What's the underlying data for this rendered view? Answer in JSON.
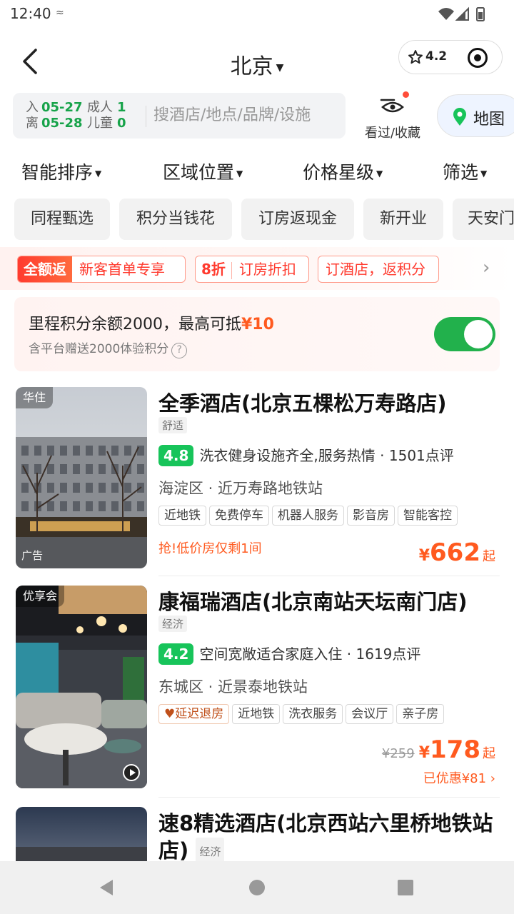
{
  "status_bar": {
    "time": "12:40"
  },
  "header": {
    "city": "北京",
    "capsule_rating": "4.2"
  },
  "search": {
    "checkin_label": "入",
    "checkin_date": "05-27",
    "checkout_label": "离",
    "checkout_date": "05-28",
    "adults_label": "成人",
    "adults": "1",
    "children_label": "儿童",
    "children": "0",
    "placeholder": "搜酒店/地点/品牌/设施",
    "viewed_label": "看过/收藏",
    "map_label": "地图"
  },
  "sort_bar": [
    "智能排序",
    "区域位置",
    "价格星级",
    "筛选"
  ],
  "quick_chips": [
    "同程甄选",
    "积分当钱花",
    "订房返现金",
    "新开业",
    "天安门"
  ],
  "promos": [
    {
      "lead": "全额返",
      "rest": "新客首单专享"
    },
    {
      "lead": "8折",
      "rest": "订房折扣"
    },
    {
      "lead": "",
      "rest": "订酒店，返积分"
    }
  ],
  "points_card": {
    "main_text": "里程积分余额2000，最高可抵",
    "highlight": "¥10",
    "sub_text": "含平台赠送2000体验积分",
    "toggle_on": true
  },
  "hotels": [
    {
      "badge": "华住",
      "ad_label": "广告",
      "name": "全季酒店(北京五棵松万寿路店)",
      "level": "舒适",
      "score": "4.8",
      "review_summary": "洗衣健身设施齐全,服务热情 · 1501点评",
      "location": "海淀区 · 近万寿路地铁站",
      "tags": [
        "近地铁",
        "免费停车",
        "机器人服务",
        "影音房",
        "智能客控"
      ],
      "urgent": "抢!低价房仅剩1间",
      "price_symbol": "¥",
      "price": "662",
      "price_suffix": "起"
    },
    {
      "badge": "优享会",
      "name": "康福瑞酒店(北京南站天坛南门店)",
      "level": "经济",
      "score": "4.2",
      "review_summary": "空间宽敞适合家庭入住 · 1619点评",
      "location": "东城区 · 近景泰地铁站",
      "tags": [
        "延迟退房",
        "近地铁",
        "洗衣服务",
        "会议厅",
        "亲子房"
      ],
      "original_price": "¥259",
      "price_symbol": "¥",
      "price": "178",
      "price_suffix": "起",
      "saved": "已优惠¥81"
    },
    {
      "name": "速8精选酒店(北京西站六里桥地铁站店)",
      "level": "经济"
    }
  ],
  "colors": {
    "brand_green": "#17c45a",
    "price_orange": "#ff5a1f",
    "promo_red": "#ff3b2f"
  }
}
